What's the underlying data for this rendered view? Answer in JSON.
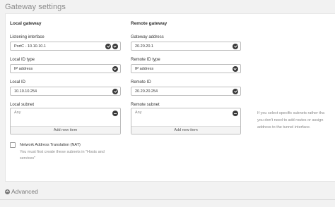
{
  "section": {
    "title": "Gateway settings"
  },
  "local": {
    "title": "Local gateway",
    "listening_interface": {
      "label": "Listening interface",
      "value": "PortC - 10.10.10.1"
    },
    "id_type": {
      "label": "Local ID type",
      "value": "IP address"
    },
    "id": {
      "label": "Local ID",
      "value": "10.10.10.254"
    },
    "subnet": {
      "label": "Local subnet",
      "item": "Any",
      "add_label": "Add new item"
    }
  },
  "remote": {
    "title": "Remote gateway",
    "gateway_address": {
      "label": "Gateway address",
      "value": "20.20.20.1"
    },
    "id_type": {
      "label": "Remote ID type",
      "value": "IP address"
    },
    "id": {
      "label": "Remote ID",
      "value": "20.20.20.254"
    },
    "subnet": {
      "label": "Remote subnet",
      "item": "Any",
      "add_label": "Add new item"
    }
  },
  "nat": {
    "label": "Network Address Translation (NAT)",
    "help": "You must first create these subnets in \"Hosts and services\"",
    "checked": false
  },
  "side_help": {
    "line1": "If you select specific subnets rather tha",
    "line2": "you don't need to add routes or assign",
    "line3": "address to the tunnel interface."
  },
  "advanced": {
    "label": "Advanced"
  }
}
